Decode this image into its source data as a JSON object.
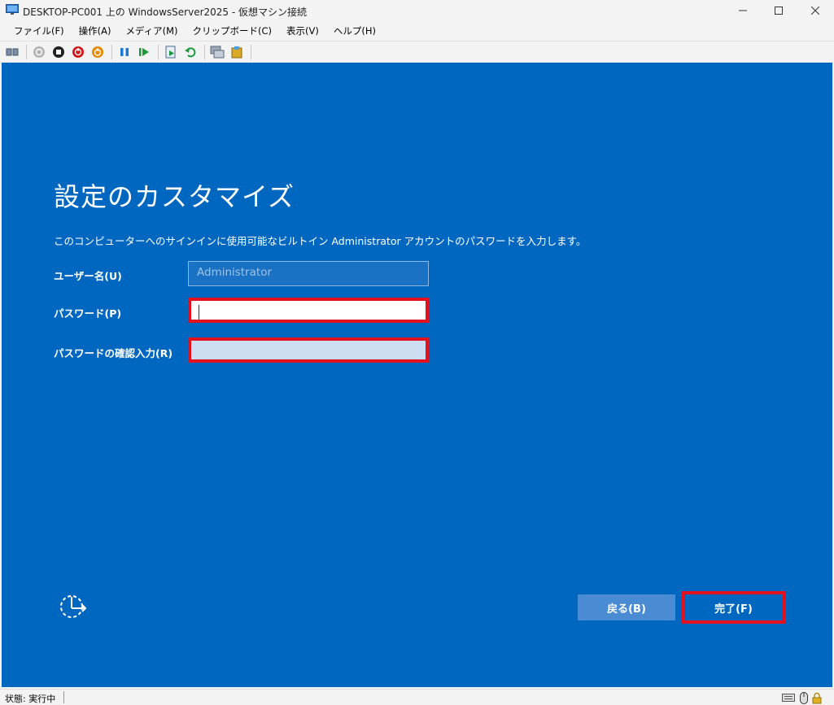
{
  "window": {
    "title": "DESKTOP-PC001 上の WindowsServer2025 - 仮想マシン接続",
    "minimize_glyph": "—",
    "maximize_glyph": "☐",
    "close_glyph": "✕"
  },
  "menu": {
    "items": [
      "ファイル(F)",
      "操作(A)",
      "メディア(M)",
      "クリップボード(C)",
      "表示(V)",
      "ヘルプ(H)"
    ]
  },
  "toolbar": {
    "icons": [
      "ctrl-alt-del-icon",
      "start-icon",
      "turn-off-icon",
      "shutdown-icon",
      "save-state-icon",
      "pause-icon",
      "resume-icon",
      "checkpoint-icon",
      "revert-icon",
      "enhanced-session-icon",
      "share-icon"
    ]
  },
  "setup": {
    "heading": "設定のカスタマイズ",
    "description": "このコンピューターへのサインインに使用可能なビルトイン Administrator アカウントのパスワードを入力します。",
    "username_label": "ユーザー名(U)",
    "username_value": "Administrator",
    "password_label": "パスワード(P)",
    "confirm_label": "パスワードの確認入力(R)",
    "back_button": "戻る(B)",
    "finish_button": "完了(F)",
    "highlight_color": "#e3101e",
    "background_color": "#0067c0"
  },
  "status": {
    "text": "状態: 実行中"
  }
}
